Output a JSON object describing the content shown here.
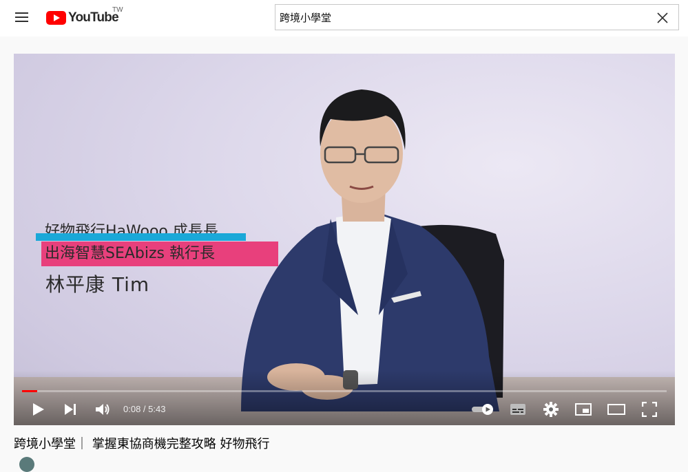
{
  "header": {
    "logo_text": "YouTube",
    "region": "TW",
    "search": {
      "value": "跨境小學堂",
      "placeholder": "搜尋"
    }
  },
  "video": {
    "overlay": {
      "line1": "好物飛行HaWooo 成長長",
      "line2": "出海智慧SEAbizs 執行長",
      "line3": "林平康 Tim"
    },
    "progress_fraction": 0.024,
    "time": {
      "current": "0:08",
      "duration": "5:43"
    },
    "colors": {
      "played": "#ff0000",
      "overlay_blue": "#1aa8d8",
      "overlay_pink": "#e8407c"
    }
  },
  "title": "跨境小學堂｜ 掌握東協商機完整攻略 好物飛行"
}
